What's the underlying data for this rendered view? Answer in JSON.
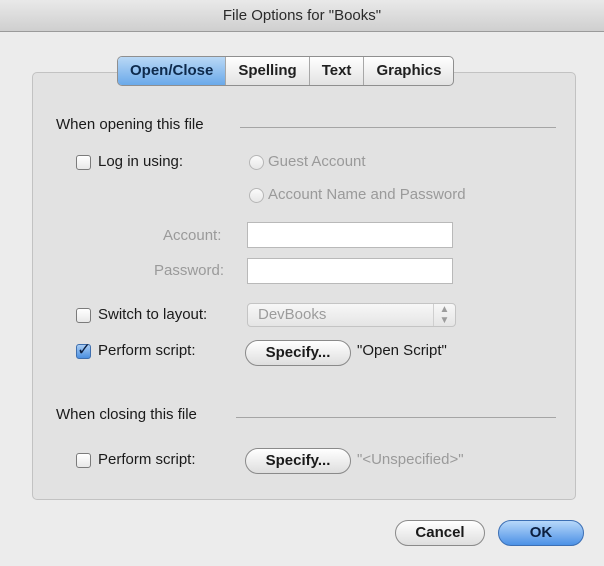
{
  "window": {
    "title": "File Options for \"Books\""
  },
  "tabs": [
    {
      "label": "Open/Close",
      "active": true
    },
    {
      "label": "Spelling",
      "active": false
    },
    {
      "label": "Text",
      "active": false
    },
    {
      "label": "Graphics",
      "active": false
    }
  ],
  "opening": {
    "section_label": "When opening this file",
    "login": {
      "checkbox_label": "Log in using:",
      "checked": false,
      "guest_option": "Guest Account",
      "account_option": "Account Name and Password",
      "account_label": "Account:",
      "account_value": "",
      "password_label": "Password:",
      "password_value": ""
    },
    "switch_layout": {
      "checkbox_label": "Switch to layout:",
      "checked": false,
      "selected_layout": "DevBooks"
    },
    "perform_script": {
      "checkbox_label": "Perform script:",
      "checked": true,
      "specify_label": "Specify...",
      "script_name": "\"Open Script\""
    }
  },
  "closing": {
    "section_label": "When closing this file",
    "perform_script": {
      "checkbox_label": "Perform script:",
      "checked": false,
      "specify_label": "Specify...",
      "script_name": "\"<Unspecified>\""
    }
  },
  "buttons": {
    "cancel": "Cancel",
    "ok": "OK"
  },
  "colors": {
    "accent": "#4c91e6",
    "disabled_text": "#9a9a9a",
    "window_bg": "#ececec"
  }
}
